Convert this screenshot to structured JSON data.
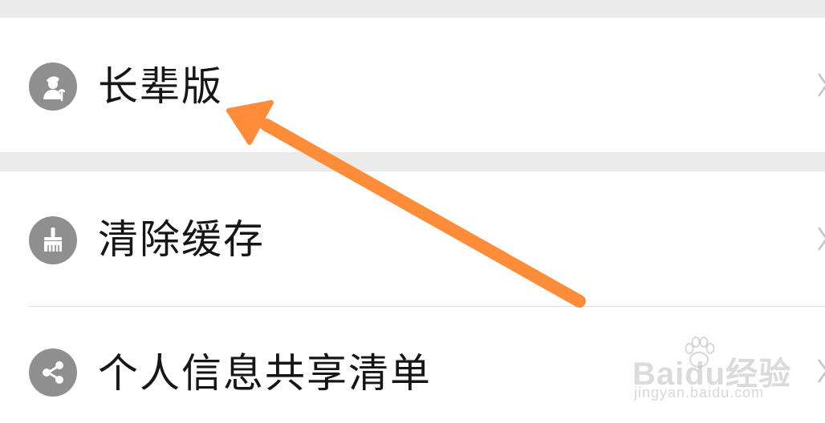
{
  "menu": {
    "items": [
      {
        "label": "长辈版",
        "icon": "elder-person-icon"
      },
      {
        "label": "清除缓存",
        "icon": "broom-icon"
      },
      {
        "label": "个人信息共享清单",
        "icon": "share-icon"
      }
    ]
  },
  "annotation": {
    "arrow_color": "#ff8c38",
    "target": "长辈版"
  },
  "watermark": {
    "logo_text": "Baidu经验",
    "url": "jingyan.baidu.com"
  },
  "colors": {
    "background": "#ffffff",
    "section_gap": "#ebebeb",
    "icon_circle": "#8f8f8f",
    "label_text": "#161616",
    "arrow": "#ff8c38"
  }
}
